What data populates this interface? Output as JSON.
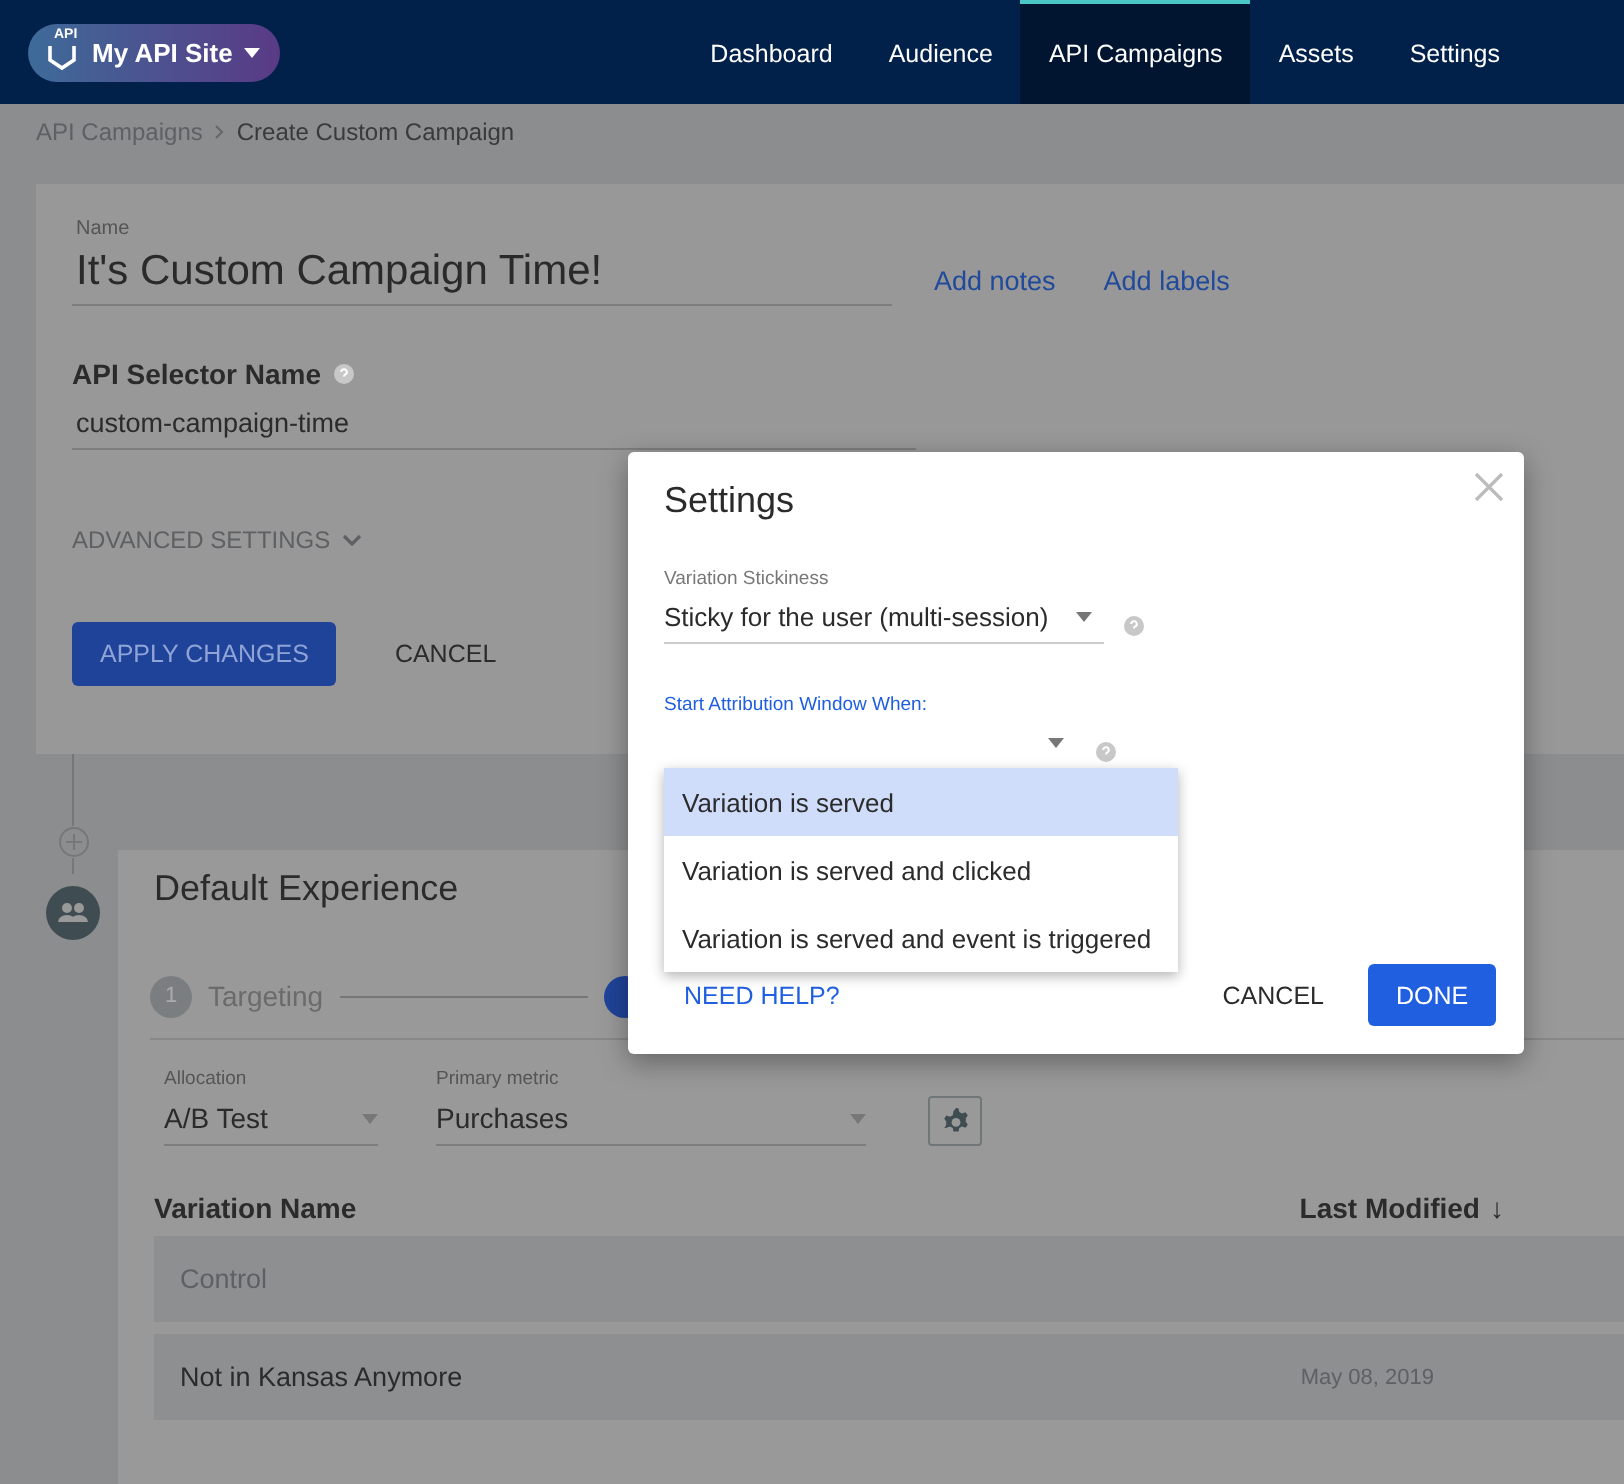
{
  "header": {
    "logo_text": "API",
    "site_name": "My API Site",
    "nav": [
      {
        "label": "Dashboard",
        "selected": false
      },
      {
        "label": "Audience",
        "selected": false
      },
      {
        "label": "API Campaigns",
        "selected": true
      },
      {
        "label": "Assets",
        "selected": false
      },
      {
        "label": "Settings",
        "selected": false
      }
    ]
  },
  "breadcrumb": [
    "API Campaigns",
    "Create Custom Campaign"
  ],
  "campaign": {
    "name_label": "Name",
    "name": "It's Custom Campaign Time!",
    "links": [
      "Add notes",
      "Add labels"
    ],
    "selector_label": "API Selector Name",
    "selector_value": "custom-campaign-time",
    "advanced_settings": "ADVANCED SETTINGS",
    "buttons": [
      "APPLY CHANGES",
      "CANCEL"
    ]
  },
  "experience": {
    "title": "Default Experience",
    "steps": [
      {
        "number": "1",
        "label": "Targeting",
        "active": false
      },
      {
        "active": true
      }
    ],
    "allocation": {
      "label": "Allocation",
      "value": "A/B Test"
    },
    "primary_metric": {
      "label": "Primary metric",
      "value": "Purchases"
    },
    "table": {
      "columns": [
        {
          "label": "Variation Name"
        },
        {
          "label": "Last Modified",
          "sort": "↓"
        }
      ],
      "rows": [
        {
          "name": "Control",
          "disabled": true
        },
        {
          "name": "Not in Kansas Anymore",
          "last_modified": "May 08, 2019",
          "disabled": false
        }
      ]
    }
  },
  "modal": {
    "title": "Settings",
    "fields": [
      {
        "label": "Variation Stickiness",
        "value": "Sticky for the user (multi-session)",
        "focused": false
      },
      {
        "label": "Start Attribution Window When:",
        "focused": true
      }
    ],
    "options": [
      {
        "label": "Variation is served",
        "selected": true
      },
      {
        "label": "Variation is served and clicked",
        "selected": false
      },
      {
        "label": "Variation is served and event is triggered",
        "selected": false
      }
    ],
    "help_link": "NEED HELP?",
    "buttons": [
      "CANCEL",
      "DONE"
    ]
  }
}
